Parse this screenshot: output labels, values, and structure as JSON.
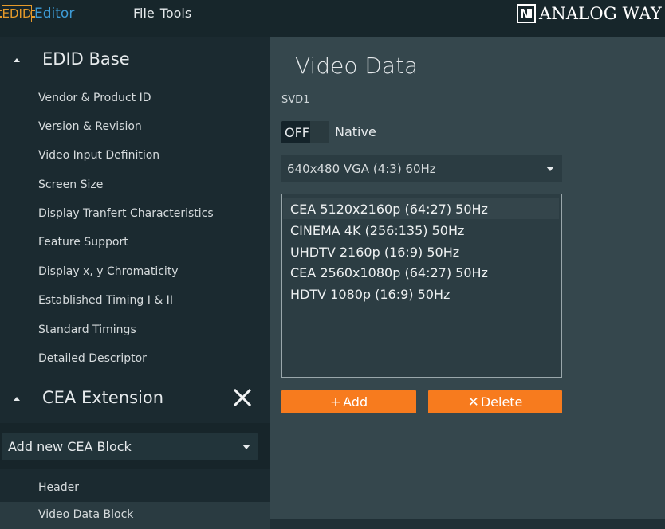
{
  "app": {
    "logo_text": "EDID",
    "name": "Editor",
    "menu": [
      "File",
      "Tools"
    ],
    "brand": "ANALOG WAY",
    "colors": {
      "accent_orange": "#f77b1e",
      "logo_orange": "#e69a2a",
      "logo_blue": "#3d9bd6"
    }
  },
  "sidebar": {
    "edid_base": {
      "title": "EDID Base",
      "items": [
        "Vendor & Product ID",
        "Version & Revision",
        "Video Input Definition",
        "Screen Size",
        "Display Tranfert Characteristics",
        "Feature Support",
        "Display x, y Chromaticity",
        "Established Timing I & II",
        "Standard Timings",
        "Detailed Descriptor"
      ]
    },
    "cea": {
      "title": "CEA Extension",
      "add_block_label": "Add new CEA Block",
      "items": [
        "Header",
        "Video Data Block"
      ]
    }
  },
  "main": {
    "title": "Video Data",
    "svd_label": "SVD1",
    "toggle_state": "OFF",
    "native_label": "Native",
    "resolution_value": "640x480 VGA (4:3) 60Hz",
    "list_items": [
      "CEA 5120x2160p (64:27) 50Hz",
      "CINEMA 4K (256:135) 50Hz",
      "UHDTV 2160p (16:9) 50Hz",
      "CEA 2560x1080p (64:27) 50Hz",
      "HDTV 1080p (16:9) 50Hz"
    ],
    "add_label": "Add",
    "delete_label": "Delete"
  }
}
